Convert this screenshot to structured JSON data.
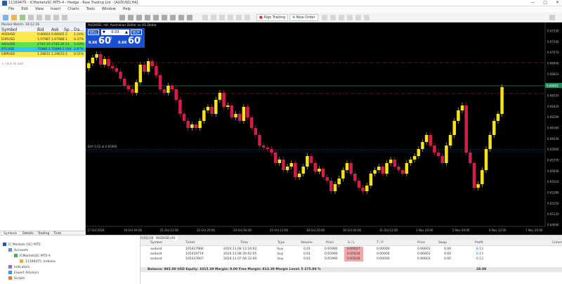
{
  "window": {
    "title": "11169475 - ICMarketsSC-MT5-4 - Hedge - Raw Trading Ltd - [AUDUSD,H4]"
  },
  "menu": [
    "File",
    "Edit",
    "View",
    "Insert",
    "Charts",
    "Tools",
    "Window",
    "Help"
  ],
  "toolbar": {
    "algo_label": "Algo Trading",
    "new_order_label": "New Order"
  },
  "market_watch": {
    "header": "Market Watch: 19:12:26",
    "columns": [
      "Symbol",
      "Bid",
      "Ask",
      "Sp...",
      "Da..."
    ],
    "rows": [
      {
        "symbol": "AUDUSD",
        "bid": "0.66603",
        "ask": "0.66605",
        "spread": "2",
        "change": "1.24%",
        "color": "#ffe94a"
      },
      {
        "symbol": "EURUSD",
        "bid": "1.07987",
        "ask": "1.07988",
        "spread": "1",
        "change": "0.37%",
        "color": "#ffe94a"
      },
      {
        "symbol": "XAUUSD",
        "bid": "2742.15",
        "ask": "2742.26",
        "spread": "11",
        "change": "1.03%",
        "color": "#5fe34a"
      },
      {
        "symbol": "BTCUSD",
        "bid": "75880.1",
        "ask": "75896.5",
        "spread": "164",
        "change": "2.87%",
        "color": "#2ec8f0"
      },
      {
        "symbol": "GBPUSD",
        "bid": "1.29631",
        "ask": "1.29633",
        "spread": "2",
        "change": "0.51%",
        "color": "#ffe94a"
      }
    ],
    "add_label": "+ click to add",
    "tabs": [
      "Symbols",
      "Details",
      "Trading",
      "Ticks"
    ]
  },
  "chart": {
    "title": "AUDUSD, H4:  Australian Dollar vs US Dollar",
    "one_click": {
      "sell_label": "SELL",
      "buy_label": "BUY",
      "volume": "0.03",
      "sell_small": "0.66",
      "sell_big": "60",
      "sell_sup": "3",
      "buy_small": "0.66",
      "buy_big": "60",
      "buy_sup": "5"
    },
    "position_label": "BUY 0.03 at 0.65990",
    "price_labels": [
      "0.67330",
      "0.67200",
      "0.67070",
      "0.66940",
      "0.66810",
      "0.66680",
      "0.66550",
      "0.66420",
      "0.66290",
      "0.66160",
      "0.66030",
      "0.65900",
      "0.65770",
      "0.65640",
      "0.65510",
      "0.65380",
      "0.65250",
      "0.65120",
      "0.64990"
    ],
    "current_price": "0.66603",
    "time_labels": [
      "17 Oct 2024",
      "18 Oct 04:00",
      "21 Oct 12:00",
      "22 Oct 20:00",
      "24 Oct 04:00",
      "25 Oct 12:00",
      "28 Oct 20:00",
      "30 Oct 04:00",
      "31 Oct 12:00",
      "1 Nov 20:00",
      "5 Nov 04:00",
      "6 Nov 12:00",
      "7 Nov 20:00"
    ],
    "colors": {
      "bull": "#f5e21b",
      "bear": "#d71c4a",
      "background": "#000000"
    }
  },
  "chart_tabs": [
    "EURUSD,H4",
    "XAUUSD,H4",
    "GBPUSD,H4",
    "AUDUSD,H4"
  ],
  "navigator": {
    "items": [
      "IC Markets (SC) MT5",
      "Accounts",
      "ICMarketsSC-MT5-4",
      "11169475: Indexes",
      "Indicators",
      "Expert Advisors",
      "Scripts"
    ]
  },
  "trade": {
    "columns": [
      "Symbol",
      "Ticket",
      "Time",
      "Type",
      "Volume",
      "Price",
      "S / L",
      "T / P",
      "Price",
      "Swap",
      "Profit",
      "Comment"
    ],
    "rows": [
      {
        "symbol": "audusd",
        "ticket": "105427966",
        "time": "2024.11.08 12:24:02",
        "type": "buy",
        "volume": "0.01",
        "price": "0.65990",
        "sl": "0.65627",
        "tp": "0.00000",
        "cur": "0.66603",
        "swap": "0.00",
        "profit": "6.13"
      },
      {
        "symbol": "audusd",
        "ticket": "105430774",
        "time": "2024.11.08 20:02:05",
        "type": "buy",
        "volume": "0.01",
        "price": "0.65990",
        "sl": "0.65628",
        "tp": "0.00000",
        "cur": "0.66603",
        "swap": "0.00",
        "profit": "6.13"
      },
      {
        "symbol": "audusd",
        "ticket": "105437807",
        "time": "2024.11.07 04:12:00",
        "type": "buy",
        "volume": "0.01",
        "price": "0.65990",
        "sl": "0.65628",
        "tp": "0.00000",
        "cur": "0.66603",
        "swap": "0.00",
        "profit": "6.13"
      }
    ],
    "balance_text": "Balance: 982.00 USD  Equity: 1015.39  Margin: 0.00  Free Margin: 813.39  Margin Level: 5 275.80 %",
    "total_profit": "28.00"
  }
}
